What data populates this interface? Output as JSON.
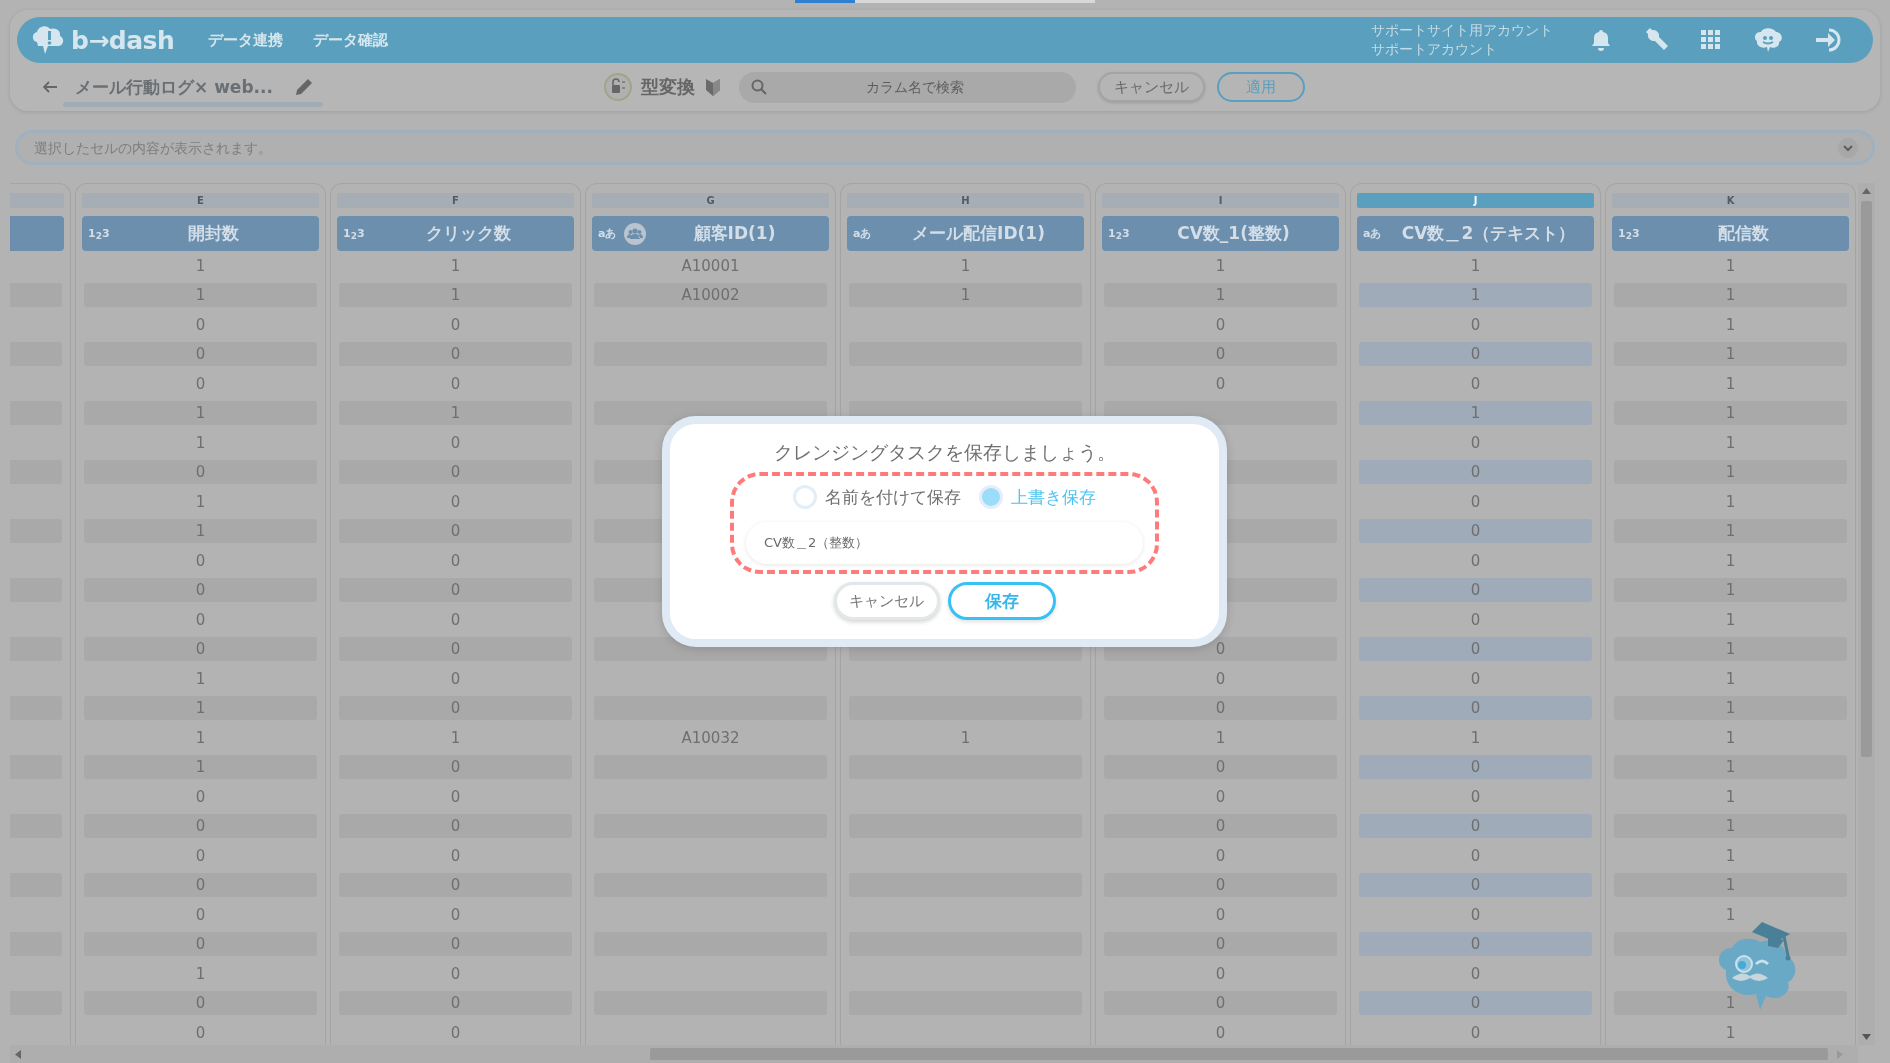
{
  "loading_bar": {
    "level": 0.2
  },
  "header": {
    "logo_text": "b→dash",
    "nav": [
      {
        "label": "データ連携"
      },
      {
        "label": "データ確認"
      }
    ],
    "account": {
      "site": "サポートサイト用アカウント",
      "name": "サポートアカウント"
    }
  },
  "toolbar": {
    "title": "メール行動ログ× web...",
    "mode_label": "型変換",
    "search": {
      "placeholder": "カラム名で検索"
    },
    "buttons": [
      {
        "label": "キャンセル",
        "kind": "plain"
      },
      {
        "label": "適用",
        "kind": "primary"
      }
    ]
  },
  "cell_bar": {
    "placeholder": "選択したセルの内容が表示されます。"
  },
  "grid": {
    "columns": [
      {
        "letter": "E",
        "type_label": "1$_{2}$3",
        "linked": false,
        "title": "開封数",
        "selected": false,
        "cells": [
          "1",
          "1",
          "0",
          "0",
          "0",
          "1",
          "1",
          "0",
          "1",
          "1",
          "0",
          "0",
          "0",
          "0",
          "1",
          "1",
          "1",
          "1",
          "0",
          "0",
          "0",
          "0",
          "0",
          "0",
          "1",
          "0",
          "0"
        ]
      },
      {
        "letter": "F",
        "type_label": "1$_{2}$3",
        "linked": false,
        "title": "クリック数",
        "selected": false,
        "cells": [
          "1",
          "1",
          "0",
          "0",
          "0",
          "1",
          "0",
          "0",
          "0",
          "0",
          "0",
          "0",
          "0",
          "0",
          "0",
          "0",
          "1",
          "0",
          "0",
          "0",
          "0",
          "0",
          "0",
          "0",
          "0",
          "0",
          "0"
        ]
      },
      {
        "letter": "G",
        "type_label": "aあ",
        "linked": true,
        "title": "顧客ID(1)",
        "selected": false,
        "cells": [
          "A10001",
          "A10002",
          null,
          null,
          null,
          null,
          null,
          null,
          null,
          null,
          null,
          null,
          null,
          null,
          null,
          null,
          "A10032",
          null,
          null,
          null,
          null,
          null,
          null,
          null,
          null,
          null,
          null
        ]
      },
      {
        "letter": "H",
        "type_label": "aあ",
        "linked": false,
        "title": "メール配信ID(1)",
        "selected": false,
        "cells": [
          "1",
          "1",
          null,
          null,
          null,
          null,
          null,
          null,
          null,
          null,
          null,
          null,
          null,
          null,
          null,
          null,
          "1",
          null,
          null,
          null,
          null,
          null,
          null,
          null,
          null,
          null,
          null
        ]
      },
      {
        "letter": "I",
        "type_label": "1$_{2}$3",
        "linked": false,
        "title": "CV数_1(整数)",
        "selected": false,
        "cells": [
          "1",
          "1",
          "0",
          "0",
          "0",
          null,
          null,
          null,
          null,
          null,
          null,
          null,
          null,
          "0",
          "0",
          "0",
          "1",
          "0",
          "0",
          "0",
          "0",
          "0",
          "0",
          "0",
          "0",
          "0",
          "0"
        ]
      },
      {
        "letter": "J",
        "type_label": "aあ",
        "linked": false,
        "title": "CV数＿2（テキスト）",
        "selected": true,
        "cells": [
          "1",
          "1",
          "0",
          "0",
          "0",
          "1",
          "0",
          "0",
          "0",
          "0",
          "0",
          "0",
          "0",
          "0",
          "0",
          "0",
          "1",
          "0",
          "0",
          "0",
          "0",
          "0",
          "0",
          "0",
          "0",
          "0",
          "0"
        ]
      },
      {
        "letter": "K",
        "type_label": "1$_{2}$3",
        "linked": false,
        "title": "配信数",
        "selected": false,
        "cells": [
          "1",
          "1",
          "1",
          "1",
          "1",
          "1",
          "1",
          "1",
          "1",
          "1",
          "1",
          "1",
          "1",
          "1",
          "1",
          "1",
          "1",
          "1",
          "1",
          "1",
          "1",
          "1",
          "1",
          null,
          null,
          "1",
          "1"
        ]
      }
    ]
  },
  "dialog": {
    "title": "クレンジングタスクを保存しましょう。",
    "options": [
      {
        "label": "名前を付けて保存",
        "selected": false
      },
      {
        "label": "上書き保存",
        "selected": true
      }
    ],
    "name_field": {
      "value": "CV数＿2（整数）"
    },
    "buttons": [
      {
        "label": "キャンセル",
        "kind": "plain"
      },
      {
        "label": "保存",
        "kind": "primary"
      }
    ]
  }
}
